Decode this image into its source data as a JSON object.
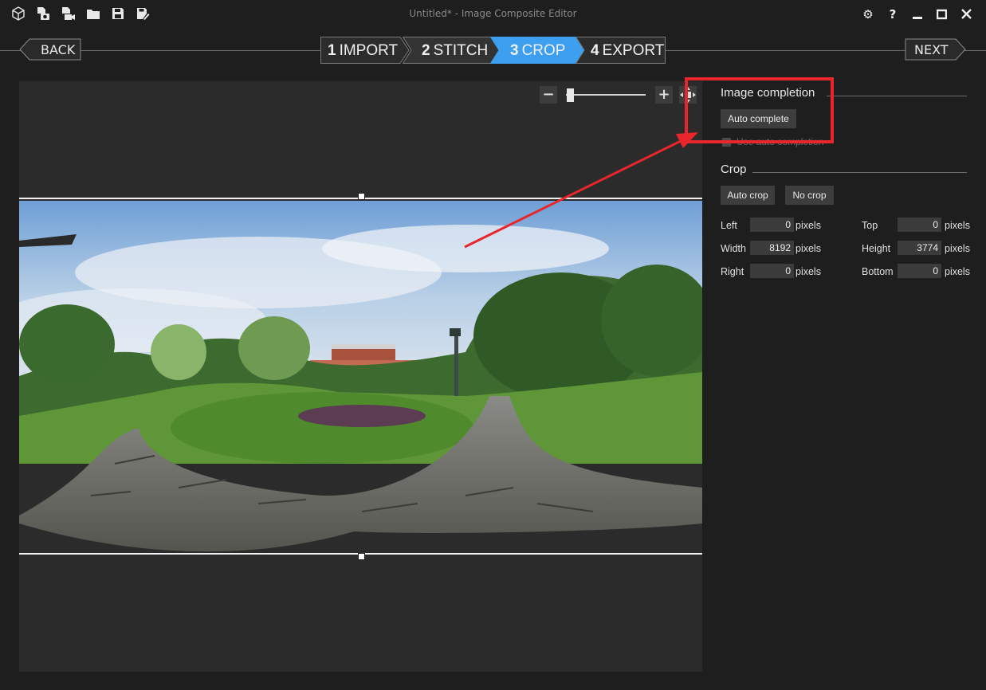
{
  "window": {
    "title": "Untitled* - Image Composite Editor"
  },
  "toolbar": {
    "icons": [
      "new-panorama-icon",
      "new-from-images-icon",
      "new-from-video-icon",
      "open-icon",
      "save-icon",
      "save-as-icon"
    ]
  },
  "window_controls": {
    "settings": "⚙",
    "help": "?",
    "minimize": "—",
    "maximize": "☐",
    "close": "✕"
  },
  "nav": {
    "back_label": "BACK",
    "next_label": "NEXT",
    "steps": [
      {
        "num": "1",
        "label": "IMPORT",
        "active": false
      },
      {
        "num": "2",
        "label": "STITCH",
        "active": false
      },
      {
        "num": "3",
        "label": "CROP",
        "active": true
      },
      {
        "num": "4",
        "label": "EXPORT",
        "active": false
      }
    ],
    "active_color": "#3c9ff0"
  },
  "zoom": {
    "minus": "−",
    "plus": "+",
    "level": 0.03
  },
  "panel": {
    "completion": {
      "title": "Image completion",
      "auto_complete_label": "Auto complete",
      "checkbox_label": "Use auto completion"
    },
    "crop": {
      "title": "Crop",
      "auto_crop_label": "Auto crop",
      "no_crop_label": "No crop",
      "unit": "pixels",
      "fields": {
        "left": {
          "label": "Left",
          "value": "0"
        },
        "top": {
          "label": "Top",
          "value": "0"
        },
        "width": {
          "label": "Width",
          "value": "8192"
        },
        "height": {
          "label": "Height",
          "value": "3774"
        },
        "right": {
          "label": "Right",
          "value": "0"
        },
        "bottom": {
          "label": "Bottom",
          "value": "0"
        }
      }
    }
  },
  "annotation": {
    "color": "#e8262c"
  }
}
